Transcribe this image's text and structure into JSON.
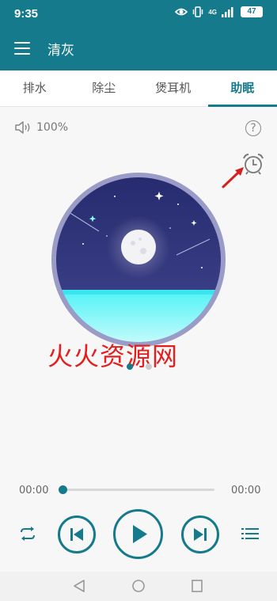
{
  "status": {
    "time": "9:35",
    "network": "4G",
    "battery": "47"
  },
  "app": {
    "title": "清灰"
  },
  "tabs": [
    {
      "label": "排水"
    },
    {
      "label": "除尘"
    },
    {
      "label": "煲耳机"
    },
    {
      "label": "助眠"
    }
  ],
  "player": {
    "volume": "100%",
    "time_elapsed": "00:00",
    "time_total": "00:00",
    "progress": 0
  },
  "watermark": "火火资源网",
  "colors": {
    "accent": "#157a8c",
    "watermark": "#e51d1d"
  }
}
